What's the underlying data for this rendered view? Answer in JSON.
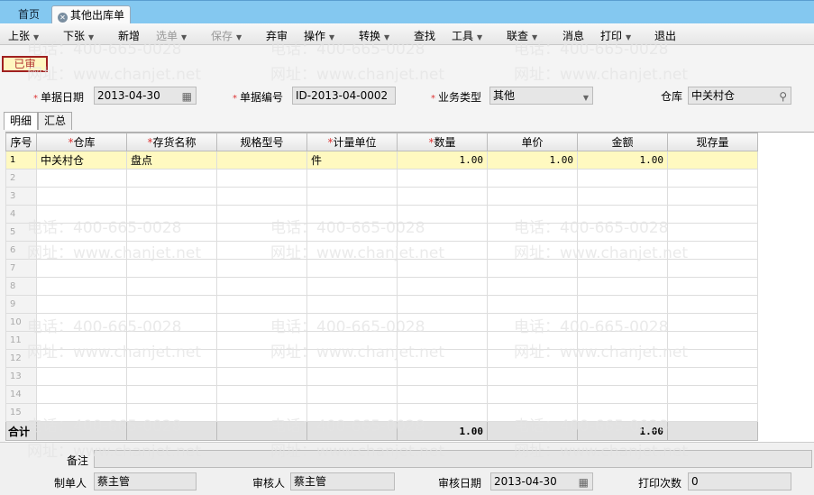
{
  "tabs": [
    {
      "label": "首页"
    },
    {
      "label": "其他出库单"
    }
  ],
  "toolbar": [
    {
      "label": "上张",
      "dropdown": true,
      "enabled": true
    },
    {
      "label": "下张",
      "dropdown": true,
      "enabled": true
    },
    {
      "label": "新增",
      "dropdown": false,
      "enabled": true
    },
    {
      "label": "选单",
      "dropdown": true,
      "enabled": false
    },
    {
      "label": "保存",
      "dropdown": true,
      "enabled": false
    },
    {
      "label": "弃审",
      "dropdown": false,
      "enabled": true
    },
    {
      "label": "操作",
      "dropdown": true,
      "enabled": true
    },
    {
      "label": "转换",
      "dropdown": true,
      "enabled": true
    },
    {
      "label": "查找",
      "dropdown": false,
      "enabled": true
    },
    {
      "label": "工具",
      "dropdown": true,
      "enabled": true
    },
    {
      "label": "联查",
      "dropdown": true,
      "enabled": true
    },
    {
      "label": "消息",
      "dropdown": false,
      "enabled": true
    },
    {
      "label": "打印",
      "dropdown": true,
      "enabled": true
    },
    {
      "label": "退出",
      "dropdown": false,
      "enabled": true
    }
  ],
  "status": "已审",
  "header": {
    "date_label": "单据日期",
    "date": "2013-04-30",
    "code_label": "单据编号",
    "code": "ID-2013-04-0002",
    "type_label": "业务类型",
    "type": "其他",
    "warehouse_label": "仓库",
    "warehouse": "中关村仓"
  },
  "subtabs": [
    "明细",
    "汇总"
  ],
  "columns": [
    "序号",
    "仓库",
    "存货名称",
    "规格型号",
    "计量单位",
    "数量",
    "单价",
    "金额",
    "现存量"
  ],
  "rows": [
    {
      "no": "1",
      "warehouse": "中关村仓",
      "item": "盘点",
      "spec": "",
      "unit": "件",
      "qty": "1.00",
      "price": "1.00",
      "amount": "1.00",
      "stock": ""
    }
  ],
  "row_count": 15,
  "total": {
    "label": "合计",
    "qty": "1.00",
    "amount": "1.00"
  },
  "footer": {
    "remark_label": "备注",
    "remark": "",
    "maker_label": "制单人",
    "maker": "蔡主管",
    "auditor_label": "审核人",
    "auditor": "蔡主管",
    "audit_date_label": "审核日期",
    "audit_date": "2013-04-30",
    "print_label": "打印次数",
    "print_count": "0"
  },
  "watermark": {
    "phone": "电话：400-665-0028",
    "site": "网址：www.chanjet.net"
  }
}
